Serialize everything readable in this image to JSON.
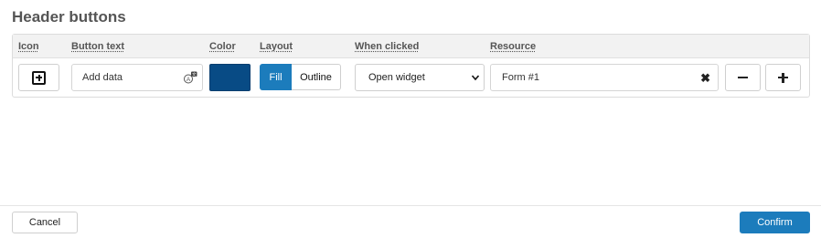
{
  "dialog": {
    "title": "Header buttons"
  },
  "columns": {
    "icon": "Icon",
    "button_text": "Button text",
    "color": "Color",
    "layout": "Layout",
    "when_clicked": "When clicked",
    "resource": "Resource"
  },
  "row": {
    "icon": "plus-square-icon",
    "button_text": "Add data",
    "color": "#084b85",
    "layout_options": [
      "Fill",
      "Outline"
    ],
    "layout_selected": "Fill",
    "when_clicked": "Open widget",
    "resource": "Form #1"
  },
  "footer": {
    "cancel_label": "Cancel",
    "confirm_label": "Confirm"
  },
  "colors": {
    "accent": "#1c7cbc",
    "swatch": "#084b85"
  }
}
